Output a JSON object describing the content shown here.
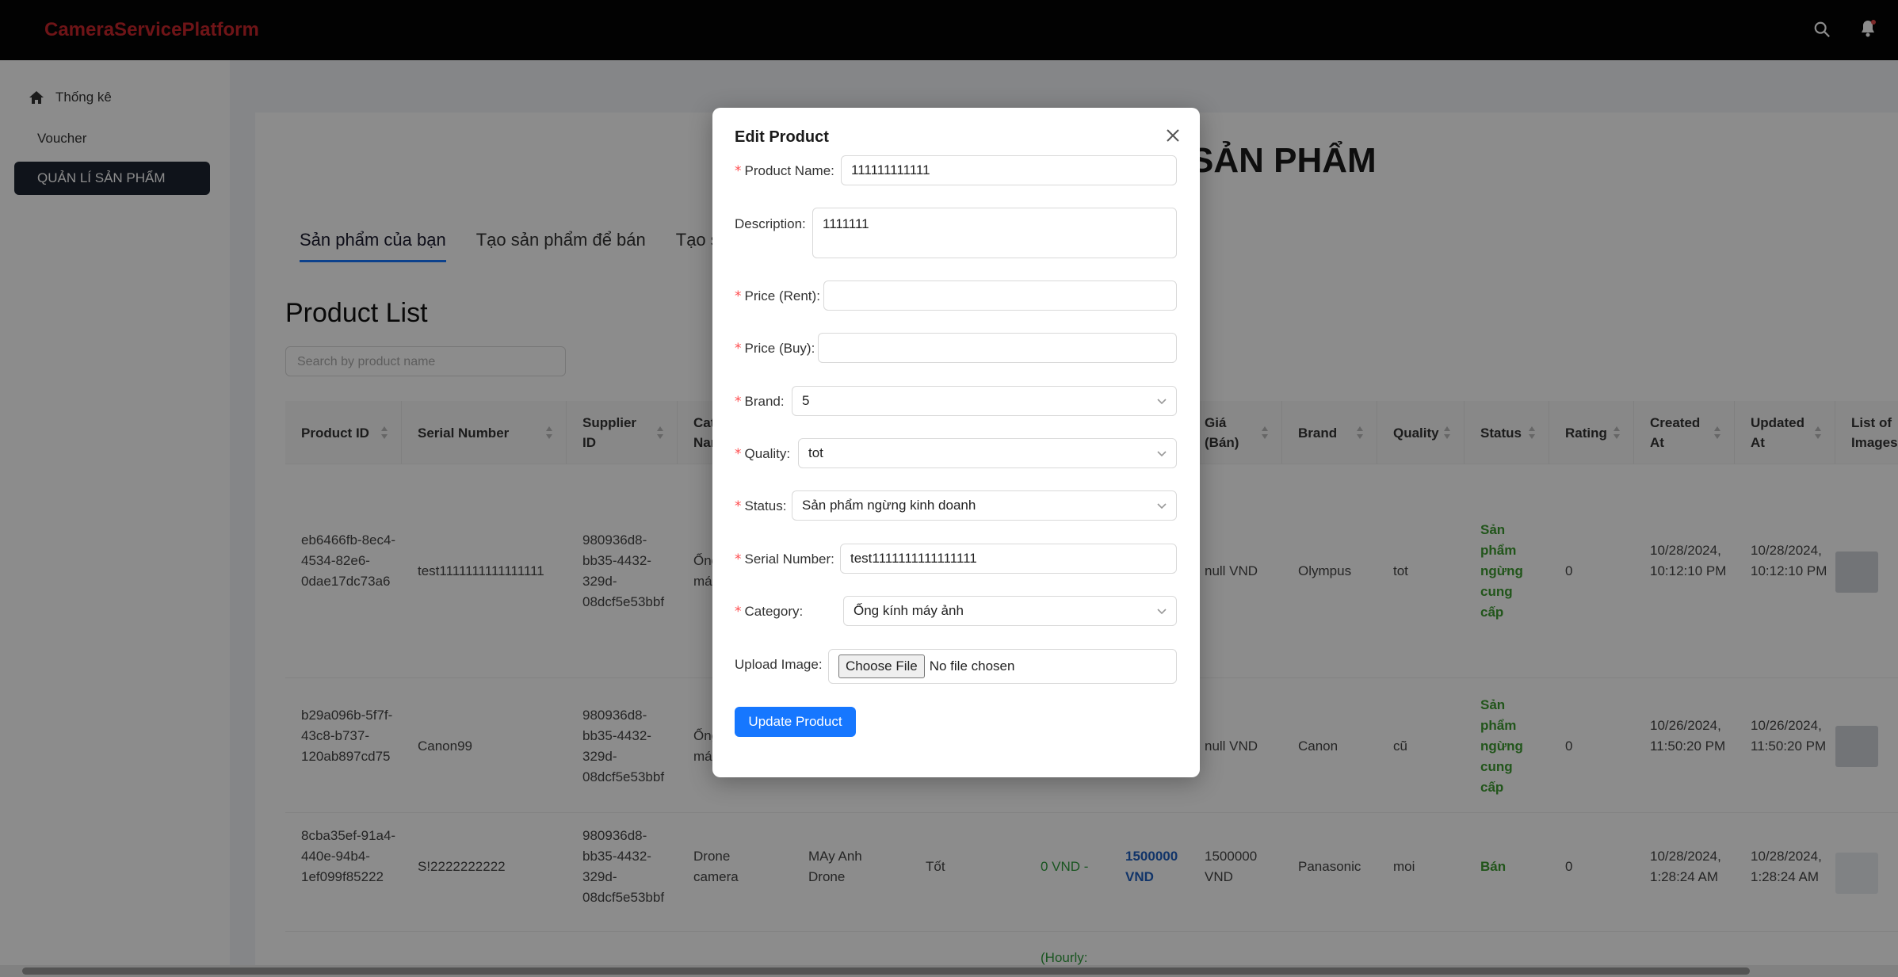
{
  "app": {
    "logo": "CameraServicePlatform"
  },
  "sidebar": {
    "items": [
      {
        "label": "Thống kê",
        "icon": "home-icon"
      },
      {
        "label": "Voucher"
      },
      {
        "label": "QUẢN LÍ SẢN PHẨM"
      }
    ]
  },
  "page": {
    "heading": "SẢN PHẨM",
    "tabs": [
      "Sản phẩm của bạn",
      "Tạo sản phẩm để bán",
      "Tạo sả"
    ],
    "list_title": "Product List",
    "search_placeholder": "Search by product name"
  },
  "table": {
    "headers": [
      "Product ID",
      "Serial Number",
      "Supplier ID",
      "Cat Nam",
      "Giá (Bán)",
      "Brand",
      "Quality",
      "Status",
      "Rating",
      "Created At",
      "Updated At",
      "List of Images"
    ],
    "rows": [
      {
        "product_id": "eb6466fb-8ec4-4534-82e6-0dae17dc73a6",
        "serial": "test1111111111111111",
        "supplier": "980936d8-bb35-4432-329d-08dcf5e53bbf",
        "cat": "Ống má",
        "price_buy": "null VND",
        "brand": "Olympus",
        "quality": "tot",
        "status": "Sản phẩm ngừng cung cấp",
        "rating": "0",
        "created": "10/28/2024, 10:12:10 PM",
        "updated": "10/28/2024, 10:12:10 PM"
      },
      {
        "product_id": "b29a096b-5f7f-43c8-b737-120ab897cd75",
        "serial": "Canon99",
        "supplier": "980936d8-bb35-4432-329d-08dcf5e53bbf",
        "cat": "Ống má",
        "price_buy": "null VND",
        "brand": "Canon",
        "quality": "cũ",
        "status": "Sản phẩm ngừng cung cấp",
        "rating": "0",
        "created": "10/26/2024, 11:50:20 PM",
        "updated": "10/26/2024, 11:50:20 PM"
      },
      {
        "product_id": "8cba35ef-91a4-440e-94b4-1ef099f85222",
        "serial": "S!2222222222",
        "supplier": "980936d8-bb35-4432-329d-08dcf5e53bbf",
        "cat": "Drone camera",
        "name": "MAy Anh Drone",
        "desc": "Tốt",
        "price_rent": "0 VND -",
        "price_highlight": "1500000 VND",
        "price_buy": "1500000 VND",
        "brand": "Panasonic",
        "quality": "moi",
        "status": "Bán",
        "rating": "0",
        "created": "10/28/2024, 1:28:24 AM",
        "updated": "10/28/2024, 1:28:24 AM"
      }
    ],
    "partial_text": "(Hourly:"
  },
  "modal": {
    "title": "Edit Product",
    "labels": {
      "product_name": "Product Name",
      "description": "Description",
      "price_rent": "Price (Rent)",
      "price_buy": "Price (Buy)",
      "brand": "Brand",
      "quality": "Quality",
      "status": "Status",
      "serial": "Serial Number",
      "category": "Category",
      "upload": "Upload Image"
    },
    "values": {
      "product_name": "111111111111",
      "description": "1111111",
      "price_rent": "",
      "price_buy": "",
      "brand": "5",
      "quality": "tot",
      "status": "Sản phẩm ngừng kinh doanh",
      "serial": "test1111111111111111",
      "category": "Ống kính máy ảnh"
    },
    "choose_file": "Choose File",
    "no_file": "No file chosen",
    "submit": "Update Product"
  }
}
